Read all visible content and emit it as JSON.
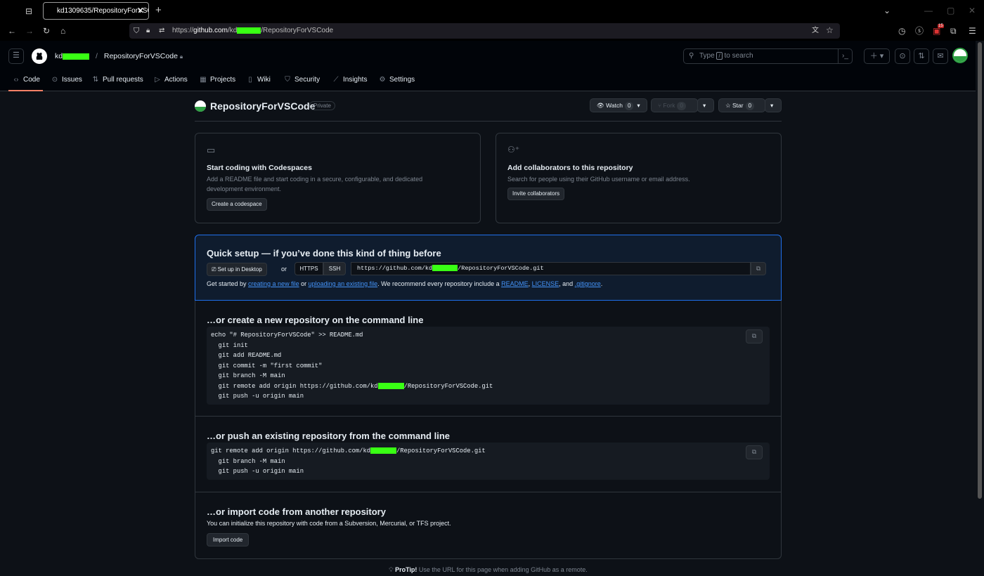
{
  "browser": {
    "tab_title": "kd1309635/RepositoryForVSCo",
    "url_prefix": "https://",
    "url_host": "github.com",
    "url_path_start": "/kd",
    "url_path_end": "/RepositoryForVSCode",
    "ext_badge": "15"
  },
  "header": {
    "owner": "kd",
    "separator": "/",
    "repo": "RepositoryForVSCode",
    "search_placeholder_before": "Type ",
    "search_key": "/",
    "search_placeholder_after": " to search"
  },
  "nav": {
    "items": [
      "Code",
      "Issues",
      "Pull requests",
      "Actions",
      "Projects",
      "Wiki",
      "Security",
      "Insights",
      "Settings"
    ]
  },
  "repo": {
    "name": "RepositoryForVSCode",
    "visibility": "Private",
    "watch_label": "Watch",
    "watch_count": "0",
    "fork_label": "Fork",
    "fork_count": "0",
    "star_label": "Star",
    "star_count": "0"
  },
  "cards": {
    "codespaces": {
      "title": "Start coding with Codespaces",
      "text": "Add a README file and start coding in a secure, configurable, and dedicated development environment.",
      "button": "Create a codespace"
    },
    "collab": {
      "title": "Add collaborators to this repository",
      "text": "Search for people using their GitHub username or email address.",
      "button": "Invite collaborators"
    }
  },
  "quick_setup": {
    "title": "Quick setup — if you’ve done this kind of thing before",
    "desktop_button": "Set up in Desktop",
    "or": "or",
    "https": "HTTPS",
    "ssh": "SSH",
    "url_start": "https://github.com/kd",
    "url_end": "/RepositoryForVSCode.git",
    "started_1": "Get started by ",
    "link_new_file": "creating a new file",
    "started_2": " or ",
    "link_upload": "uploading an existing file",
    "started_3": ". We recommend every repository include a ",
    "link_readme": "README",
    "comma": ",",
    "link_license": "LICENSE",
    "and": ", and ",
    "link_gitignore": ".gitignore",
    "period": "."
  },
  "new_repo": {
    "title": "…or create a new repository on the command line",
    "lines": [
      "echo \"# RepositoryForVSCode\" >> README.md",
      "  git init",
      "  git add README.md",
      "  git commit -m \"first commit\"",
      "  git branch -M main"
    ],
    "remote_start": "  git remote add origin https://github.com/kd",
    "remote_end": "/RepositoryForVSCode.git",
    "last_line": "  git push -u origin main"
  },
  "push_existing": {
    "title": "…or push an existing repository from the command line",
    "remote_start": "git remote add origin https://github.com/kd",
    "remote_end": "/RepositoryForVSCode.git",
    "lines": [
      "  git branch -M main",
      "  git push -u origin main"
    ]
  },
  "import": {
    "title": "…or import code from another repository",
    "text": "You can initialize this repository with code from a Subversion, Mercurial, or TFS project.",
    "button": "Import code"
  },
  "protip": {
    "label": "ProTip!",
    "text": " Use the URL for this page when adding GitHub as a remote."
  },
  "colors": {
    "accent": "#1f6feb",
    "link": "#4493f8",
    "redaction": "#39ff14",
    "bg": "#0d1117",
    "border": "#30363d"
  }
}
